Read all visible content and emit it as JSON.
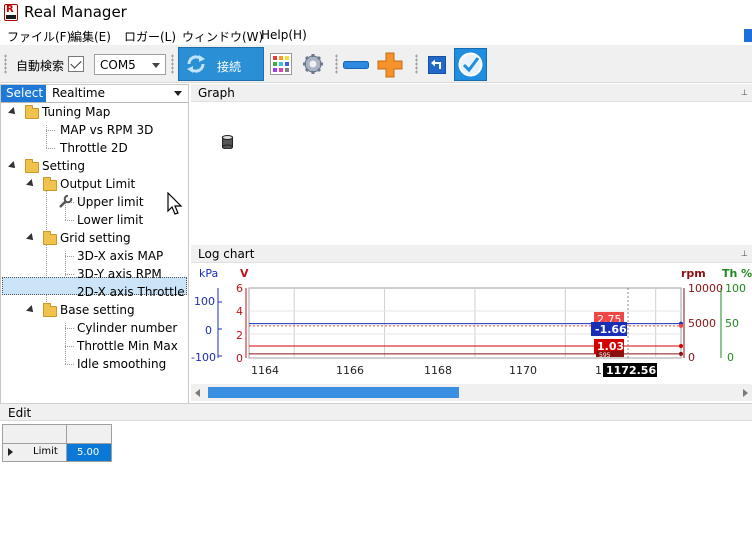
{
  "window": {
    "title": "Real Manager"
  },
  "menu": {
    "items": [
      "ファイル(F)",
      "編集(E)",
      "ロガー(L)",
      "ウィンドウ(W)",
      "Help(H)"
    ]
  },
  "toolbar": {
    "auto_search_label": "自動検索",
    "auto_search_checked": true,
    "port_value": "COM5",
    "connect_label": "接続",
    "icons": [
      "refresh-icon",
      "color-grid-icon",
      "gear-icon",
      "minus-icon",
      "plus-icon",
      "back-icon",
      "check-icon"
    ]
  },
  "left_panel": {
    "select_tab": "Select",
    "realtime_label": "Realtime",
    "tree": [
      {
        "label": "Tuning Map",
        "level": 0,
        "type": "folder"
      },
      {
        "label": "MAP vs RPM 3D",
        "level": 1,
        "type": "leaf"
      },
      {
        "label": "Throttle 2D",
        "level": 1,
        "type": "leaf"
      },
      {
        "label": "Setting",
        "level": 0,
        "type": "folder"
      },
      {
        "label": "Output Limit",
        "level": 1,
        "type": "folder"
      },
      {
        "label": "Upper limit",
        "level": 2,
        "type": "leaf",
        "selected": true
      },
      {
        "label": "Lower limit",
        "level": 2,
        "type": "leaf"
      },
      {
        "label": "Grid setting",
        "level": 1,
        "type": "folder"
      },
      {
        "label": "3D-X axis MAP",
        "level": 2,
        "type": "leaf"
      },
      {
        "label": "3D-Y axis RPM",
        "level": 2,
        "type": "leaf"
      },
      {
        "label": "2D-X axis Throttle",
        "level": 2,
        "type": "leaf"
      },
      {
        "label": "Base setting",
        "level": 1,
        "type": "folder"
      },
      {
        "label": "Cylinder number",
        "level": 2,
        "type": "leaf"
      },
      {
        "label": "Throttle Min Max",
        "level": 2,
        "type": "leaf"
      },
      {
        "label": "Idle smoothing",
        "level": 2,
        "type": "leaf"
      }
    ]
  },
  "graph_panel": {
    "title": "Graph"
  },
  "log_panel": {
    "title": "Log chart",
    "axes": {
      "kpa": {
        "label": "kPa",
        "ticks": [
          "100",
          "0",
          "-100"
        ],
        "color": "#1a2fb8"
      },
      "v": {
        "label": "V",
        "ticks": [
          "6",
          "4",
          "2",
          "0"
        ],
        "color": "#c0141c"
      },
      "rpm": {
        "label": "rpm",
        "ticks": [
          "10000",
          "5000",
          "0"
        ],
        "color": "#8b1010"
      },
      "th": {
        "label": "Th %",
        "ticks": [
          "100",
          "50",
          "0"
        ],
        "color": "#1d8a1d"
      }
    },
    "x_ticks": [
      "1164",
      "1166",
      "1168",
      "1170",
      "1"
    ],
    "cursor_value": "1172.56",
    "value_labels": [
      {
        "text": "2.75",
        "color": "#f04646"
      },
      {
        "text": "-1.66",
        "color": "#1a2fb8"
      },
      {
        "text": "1.03",
        "color": "#d40000"
      },
      {
        "text": "595",
        "color": "#8b1010"
      }
    ]
  },
  "chart_data": {
    "type": "line",
    "title": "",
    "x_ticks": [
      1164,
      1166,
      1168,
      1170,
      1172
    ],
    "xlim": [
      1163,
      1172.56
    ],
    "series": [
      {
        "name": "kPa",
        "axis": "kPa",
        "value": -1.66,
        "color": "#1a2fb8",
        "style": "solid"
      },
      {
        "name": "V",
        "axis": "V",
        "value": 2.75,
        "color": "#f04646",
        "style": "dotted"
      },
      {
        "name": "V",
        "axis": "V",
        "value": 1.03,
        "color": "#d40000",
        "style": "solid"
      },
      {
        "name": "rpm",
        "axis": "rpm",
        "value": 595,
        "color": "#8b1010",
        "style": "solid"
      }
    ],
    "ylim_kpa": [
      -100,
      100
    ],
    "ylim_v": [
      0,
      6
    ],
    "ylim_rpm": [
      0,
      10000
    ],
    "ylim_th": [
      0,
      100
    ],
    "grid": true
  },
  "edit_panel": {
    "title": "Edit",
    "rows": [
      {
        "label": "Limit",
        "value": "5.00"
      }
    ]
  }
}
